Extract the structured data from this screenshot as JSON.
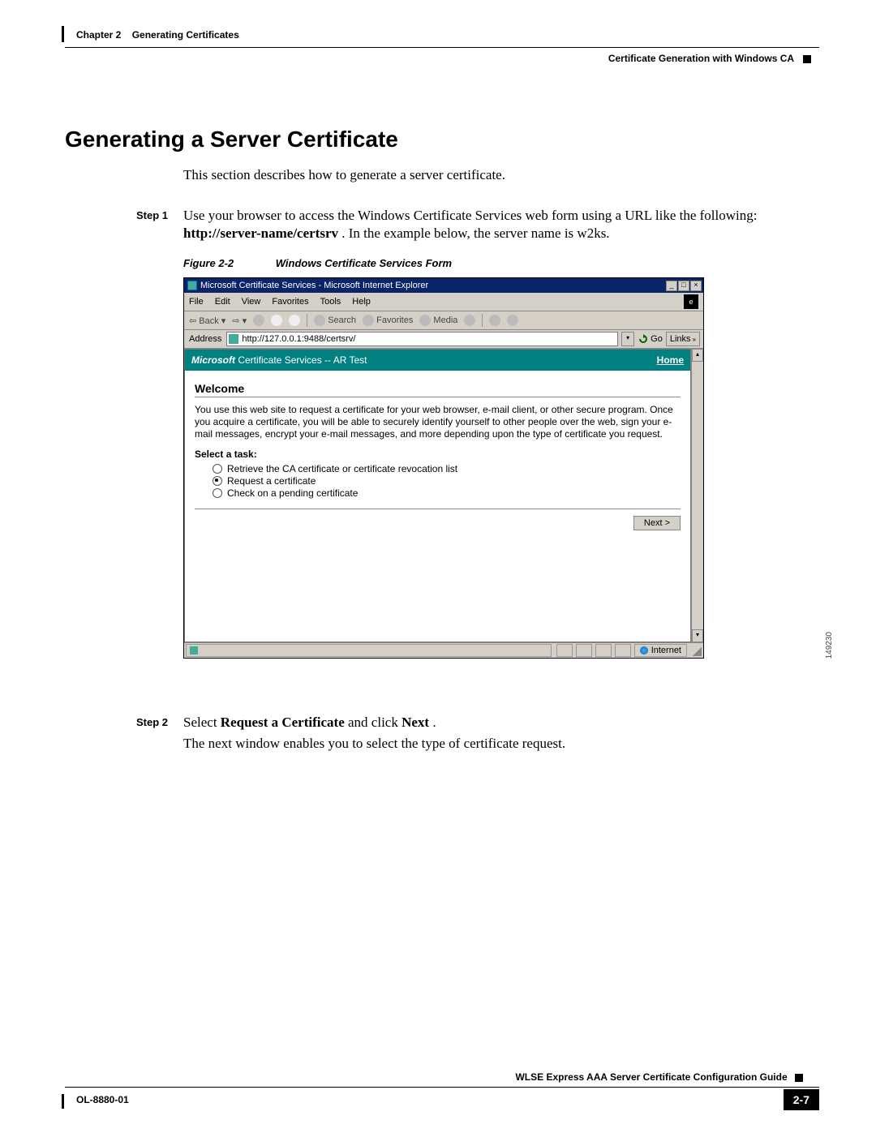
{
  "header": {
    "chapter": "Chapter 2",
    "chapter_title": "Generating Certificates",
    "right": "Certificate Generation with Windows CA"
  },
  "section_heading": "Generating a Server Certificate",
  "intro": "This section describes how to generate a server certificate.",
  "step1": {
    "label": "Step 1",
    "text_a": "Use your browser to access the Windows Certificate Services web form using a URL like the following: ",
    "text_b": "http://server-name/certsrv",
    "text_c": ". In the example below, the server name is w2ks."
  },
  "figure": {
    "num": "Figure 2-2",
    "caption": "Windows Certificate Services Form",
    "side_num": "149230"
  },
  "ie": {
    "title": "Microsoft Certificate Services - Microsoft Internet Explorer",
    "menu": {
      "file": "File",
      "edit": "Edit",
      "view": "View",
      "favorites": "Favorites",
      "tools": "Tools",
      "help": "Help"
    },
    "toolbar": {
      "back": "Back",
      "search": "Search",
      "favorites": "Favorites",
      "media": "Media"
    },
    "address_label": "Address",
    "address_url": "http://127.0.0.1:9488/certsrv/",
    "go": "Go",
    "links": "Links",
    "banner_brand": "Microsoft",
    "banner_rest": " Certificate Services  --  AR Test",
    "home": "Home",
    "welcome": "Welcome",
    "welcome_text": "You use this web site to request a certificate for your web browser, e-mail client, or other secure program. Once you acquire a certificate, you will be able to securely identify yourself to other people over the web, sign your e-mail messages, encrypt your e-mail messages, and more depending upon the type of certificate you request.",
    "select_task": "Select a task:",
    "opt1": "Retrieve the CA certificate or certificate revocation list",
    "opt2": "Request a certificate",
    "opt3": "Check on a pending certificate",
    "next": "Next >",
    "status_zone": "Internet"
  },
  "step2": {
    "label": "Step 2",
    "a": "Select ",
    "b": "Request a Certificate",
    "c": " and click ",
    "d": "Next",
    "e": ".",
    "line2": "The next window enables you to select the type of certificate request."
  },
  "footer": {
    "guide": "WLSE Express AAA Server Certificate Configuration Guide",
    "doc": "OL-8880-01",
    "page": "2-7"
  }
}
